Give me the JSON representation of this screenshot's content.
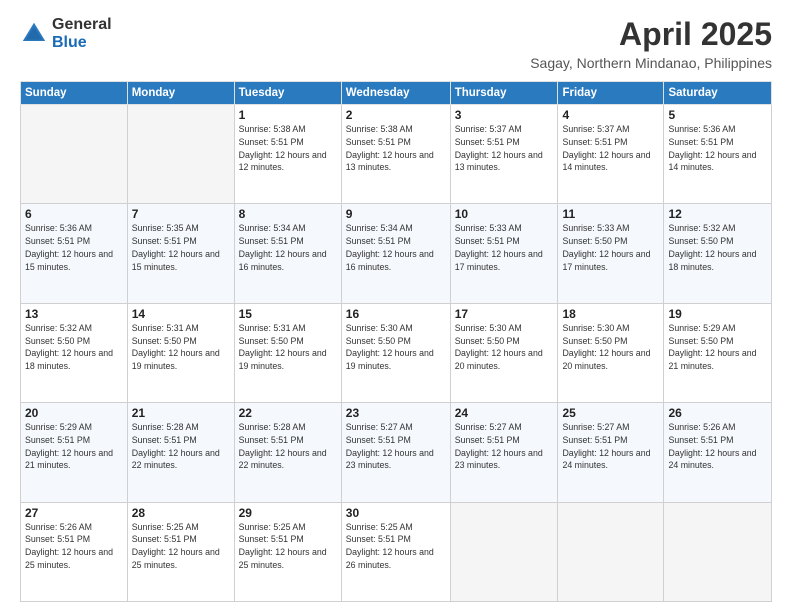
{
  "logo": {
    "general": "General",
    "blue": "Blue"
  },
  "title": "April 2025",
  "subtitle": "Sagay, Northern Mindanao, Philippines",
  "headers": [
    "Sunday",
    "Monday",
    "Tuesday",
    "Wednesday",
    "Thursday",
    "Friday",
    "Saturday"
  ],
  "weeks": [
    [
      {
        "day": "",
        "sunrise": "",
        "sunset": "",
        "daylight": "",
        "empty": true
      },
      {
        "day": "",
        "sunrise": "",
        "sunset": "",
        "daylight": "",
        "empty": true
      },
      {
        "day": "1",
        "sunrise": "Sunrise: 5:38 AM",
        "sunset": "Sunset: 5:51 PM",
        "daylight": "Daylight: 12 hours and 12 minutes."
      },
      {
        "day": "2",
        "sunrise": "Sunrise: 5:38 AM",
        "sunset": "Sunset: 5:51 PM",
        "daylight": "Daylight: 12 hours and 13 minutes."
      },
      {
        "day": "3",
        "sunrise": "Sunrise: 5:37 AM",
        "sunset": "Sunset: 5:51 PM",
        "daylight": "Daylight: 12 hours and 13 minutes."
      },
      {
        "day": "4",
        "sunrise": "Sunrise: 5:37 AM",
        "sunset": "Sunset: 5:51 PM",
        "daylight": "Daylight: 12 hours and 14 minutes."
      },
      {
        "day": "5",
        "sunrise": "Sunrise: 5:36 AM",
        "sunset": "Sunset: 5:51 PM",
        "daylight": "Daylight: 12 hours and 14 minutes."
      }
    ],
    [
      {
        "day": "6",
        "sunrise": "Sunrise: 5:36 AM",
        "sunset": "Sunset: 5:51 PM",
        "daylight": "Daylight: 12 hours and 15 minutes."
      },
      {
        "day": "7",
        "sunrise": "Sunrise: 5:35 AM",
        "sunset": "Sunset: 5:51 PM",
        "daylight": "Daylight: 12 hours and 15 minutes."
      },
      {
        "day": "8",
        "sunrise": "Sunrise: 5:34 AM",
        "sunset": "Sunset: 5:51 PM",
        "daylight": "Daylight: 12 hours and 16 minutes."
      },
      {
        "day": "9",
        "sunrise": "Sunrise: 5:34 AM",
        "sunset": "Sunset: 5:51 PM",
        "daylight": "Daylight: 12 hours and 16 minutes."
      },
      {
        "day": "10",
        "sunrise": "Sunrise: 5:33 AM",
        "sunset": "Sunset: 5:51 PM",
        "daylight": "Daylight: 12 hours and 17 minutes."
      },
      {
        "day": "11",
        "sunrise": "Sunrise: 5:33 AM",
        "sunset": "Sunset: 5:50 PM",
        "daylight": "Daylight: 12 hours and 17 minutes."
      },
      {
        "day": "12",
        "sunrise": "Sunrise: 5:32 AM",
        "sunset": "Sunset: 5:50 PM",
        "daylight": "Daylight: 12 hours and 18 minutes."
      }
    ],
    [
      {
        "day": "13",
        "sunrise": "Sunrise: 5:32 AM",
        "sunset": "Sunset: 5:50 PM",
        "daylight": "Daylight: 12 hours and 18 minutes."
      },
      {
        "day": "14",
        "sunrise": "Sunrise: 5:31 AM",
        "sunset": "Sunset: 5:50 PM",
        "daylight": "Daylight: 12 hours and 19 minutes."
      },
      {
        "day": "15",
        "sunrise": "Sunrise: 5:31 AM",
        "sunset": "Sunset: 5:50 PM",
        "daylight": "Daylight: 12 hours and 19 minutes."
      },
      {
        "day": "16",
        "sunrise": "Sunrise: 5:30 AM",
        "sunset": "Sunset: 5:50 PM",
        "daylight": "Daylight: 12 hours and 19 minutes."
      },
      {
        "day": "17",
        "sunrise": "Sunrise: 5:30 AM",
        "sunset": "Sunset: 5:50 PM",
        "daylight": "Daylight: 12 hours and 20 minutes."
      },
      {
        "day": "18",
        "sunrise": "Sunrise: 5:30 AM",
        "sunset": "Sunset: 5:50 PM",
        "daylight": "Daylight: 12 hours and 20 minutes."
      },
      {
        "day": "19",
        "sunrise": "Sunrise: 5:29 AM",
        "sunset": "Sunset: 5:50 PM",
        "daylight": "Daylight: 12 hours and 21 minutes."
      }
    ],
    [
      {
        "day": "20",
        "sunrise": "Sunrise: 5:29 AM",
        "sunset": "Sunset: 5:51 PM",
        "daylight": "Daylight: 12 hours and 21 minutes."
      },
      {
        "day": "21",
        "sunrise": "Sunrise: 5:28 AM",
        "sunset": "Sunset: 5:51 PM",
        "daylight": "Daylight: 12 hours and 22 minutes."
      },
      {
        "day": "22",
        "sunrise": "Sunrise: 5:28 AM",
        "sunset": "Sunset: 5:51 PM",
        "daylight": "Daylight: 12 hours and 22 minutes."
      },
      {
        "day": "23",
        "sunrise": "Sunrise: 5:27 AM",
        "sunset": "Sunset: 5:51 PM",
        "daylight": "Daylight: 12 hours and 23 minutes."
      },
      {
        "day": "24",
        "sunrise": "Sunrise: 5:27 AM",
        "sunset": "Sunset: 5:51 PM",
        "daylight": "Daylight: 12 hours and 23 minutes."
      },
      {
        "day": "25",
        "sunrise": "Sunrise: 5:27 AM",
        "sunset": "Sunset: 5:51 PM",
        "daylight": "Daylight: 12 hours and 24 minutes."
      },
      {
        "day": "26",
        "sunrise": "Sunrise: 5:26 AM",
        "sunset": "Sunset: 5:51 PM",
        "daylight": "Daylight: 12 hours and 24 minutes."
      }
    ],
    [
      {
        "day": "27",
        "sunrise": "Sunrise: 5:26 AM",
        "sunset": "Sunset: 5:51 PM",
        "daylight": "Daylight: 12 hours and 25 minutes."
      },
      {
        "day": "28",
        "sunrise": "Sunrise: 5:25 AM",
        "sunset": "Sunset: 5:51 PM",
        "daylight": "Daylight: 12 hours and 25 minutes."
      },
      {
        "day": "29",
        "sunrise": "Sunrise: 5:25 AM",
        "sunset": "Sunset: 5:51 PM",
        "daylight": "Daylight: 12 hours and 25 minutes."
      },
      {
        "day": "30",
        "sunrise": "Sunrise: 5:25 AM",
        "sunset": "Sunset: 5:51 PM",
        "daylight": "Daylight: 12 hours and 26 minutes."
      },
      {
        "day": "",
        "sunrise": "",
        "sunset": "",
        "daylight": "",
        "empty": true
      },
      {
        "day": "",
        "sunrise": "",
        "sunset": "",
        "daylight": "",
        "empty": true
      },
      {
        "day": "",
        "sunrise": "",
        "sunset": "",
        "daylight": "",
        "empty": true
      }
    ]
  ]
}
